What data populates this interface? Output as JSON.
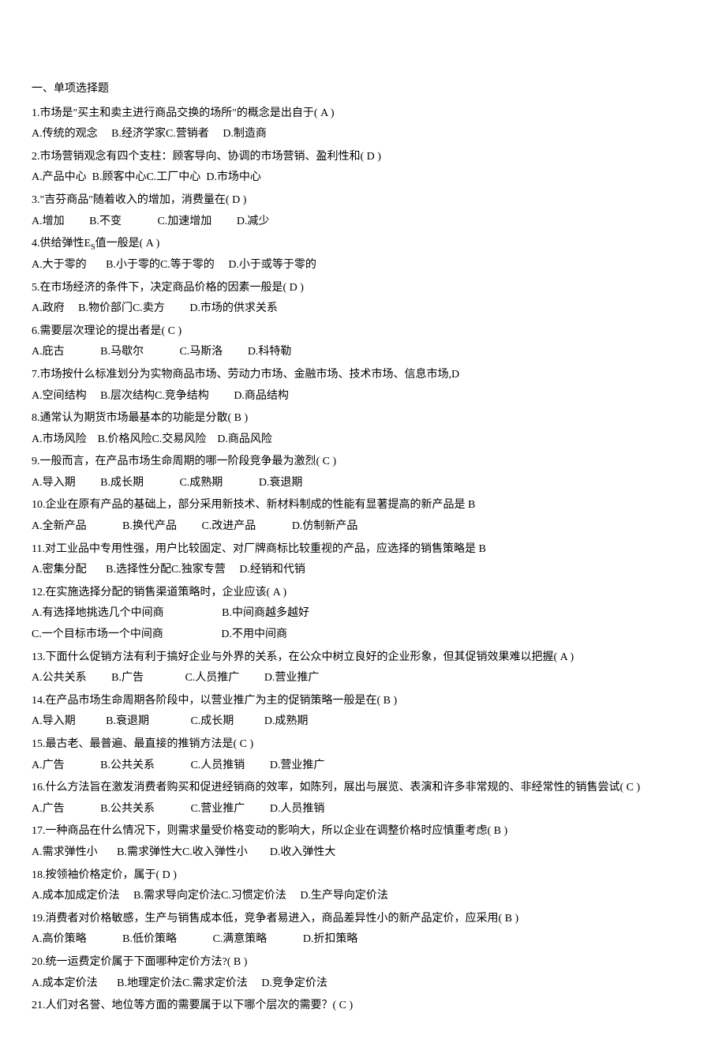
{
  "section_title": "一、单项选择题",
  "questions": [
    {
      "num": "1.",
      "text": "市场是\"买主和卖主进行商品交换的场所\"的概念是出自于(    A    )",
      "options": [
        {
          "label": "A.",
          "text": "传统的观念",
          "pad": "     "
        },
        {
          "label": "B.",
          "text": "经济学家",
          "pad": ""
        },
        {
          "label": "C.",
          "text": "营销者",
          "pad": "     "
        },
        {
          "label": "D.",
          "text": "制造商",
          "pad": ""
        }
      ]
    },
    {
      "num": "2.",
      "text": "市场营销观念有四个支柱：顾客导向、协调的市场营销、盈利性和(     D   )",
      "options": [
        {
          "label": "A.",
          "text": "产品中心",
          "pad": "  "
        },
        {
          "label": "B.",
          "text": "顾客中心",
          "pad": ""
        },
        {
          "label": "C.",
          "text": "工厂中心",
          "pad": "  "
        },
        {
          "label": "D.",
          "text": "市场中心",
          "pad": ""
        }
      ]
    },
    {
      "num": "3.",
      "text": "\"吉芬商品\"随着收入的增加，消费量在(     D   )",
      "options": [
        {
          "label": "A.",
          "text": "增加",
          "pad": "         "
        },
        {
          "label": "B.",
          "text": "不变",
          "pad": "             "
        },
        {
          "label": "C.",
          "text": "加速增加",
          "pad": "         "
        },
        {
          "label": "D.",
          "text": "减少",
          "pad": ""
        }
      ]
    },
    {
      "num": "4.",
      "text": "供给弹性E<sub>S</sub>值一般是( A     )",
      "options": [
        {
          "label": "A.",
          "text": "大于零的",
          "pad": "       "
        },
        {
          "label": "B.",
          "text": "小于零的",
          "pad": ""
        },
        {
          "label": "C.",
          "text": "等于零的",
          "pad": "     "
        },
        {
          "label": "D.",
          "text": "小于或等于零的",
          "pad": ""
        }
      ]
    },
    {
      "num": "5.",
      "text": "在市场经济的条件下，决定商品价格的因素一般是(    D    )",
      "options": [
        {
          "label": "A.",
          "text": "政府",
          "pad": "     "
        },
        {
          "label": "B.",
          "text": "物价部门",
          "pad": ""
        },
        {
          "label": "C.",
          "text": "卖方",
          "pad": "         "
        },
        {
          "label": "D.",
          "text": "市场的供求关系",
          "pad": ""
        }
      ]
    },
    {
      "num": "6.",
      "text": "需要层次理论的提出者是(  C     )",
      "options": [
        {
          "label": "A.",
          "text": "庇古",
          "pad": "             "
        },
        {
          "label": "B.",
          "text": "马歇尔",
          "pad": "             "
        },
        {
          "label": "C.",
          "text": "马斯洛",
          "pad": "         "
        },
        {
          "label": "D.",
          "text": "科特勒",
          "pad": ""
        }
      ]
    },
    {
      "num": "7.",
      "text": "市场按什么标准划分为实物商品市场、劳动力市场、金融市场、技术市场、信息市场,D",
      "options": [
        {
          "label": "A.",
          "text": "空间结构",
          "pad": "     "
        },
        {
          "label": "B.",
          "text": "层次结构",
          "pad": ""
        },
        {
          "label": "C.",
          "text": "竞争结构",
          "pad": "         "
        },
        {
          "label": "D.",
          "text": "商品结构",
          "pad": ""
        }
      ]
    },
    {
      "num": "8.",
      "text": "通常认为期货市场最基本的功能是分散(    B    )",
      "options": [
        {
          "label": "A.",
          "text": "市场风险",
          "pad": "    "
        },
        {
          "label": "B.",
          "text": "价格风险",
          "pad": ""
        },
        {
          "label": "C.",
          "text": "交易风险",
          "pad": "    "
        },
        {
          "label": "D.",
          "text": "商品风险",
          "pad": ""
        }
      ]
    },
    {
      "num": "9.",
      "text": "一般而言，在产品市场生命周期的哪一阶段竞争最为激烈(     C    )",
      "options": [
        {
          "label": "A.",
          "text": "导入期",
          "pad": "         "
        },
        {
          "label": "B.",
          "text": "成长期",
          "pad": "             "
        },
        {
          "label": "C.",
          "text": "成熟期",
          "pad": "             "
        },
        {
          "label": "D.",
          "text": "衰退期",
          "pad": ""
        }
      ]
    },
    {
      "num": "10.",
      "text": "企业在原有产品的基础上，部分采用新技术、新材料制成的性能有显著提高的新产品是 B",
      "options": [
        {
          "label": "A.",
          "text": "全新产品",
          "pad": "             "
        },
        {
          "label": "B.",
          "text": "换代产品",
          "pad": "         "
        },
        {
          "label": "C.",
          "text": "改进产品",
          "pad": "             "
        },
        {
          "label": "D.",
          "text": "仿制新产品",
          "pad": ""
        }
      ]
    },
    {
      "num": "11.",
      "text": "对工业品中专用性强，用户比较固定、对厂牌商标比较重视的产品，应选择的销售策略是 B",
      "options": [
        {
          "label": "A.",
          "text": "密集分配",
          "pad": "       "
        },
        {
          "label": "B.",
          "text": "选择性分配",
          "pad": ""
        },
        {
          "label": "C.",
          "text": "独家专营",
          "pad": "     "
        },
        {
          "label": "D.",
          "text": "经销和代销",
          "pad": ""
        }
      ]
    },
    {
      "num": "12.",
      "text": "在实施选择分配的销售渠道策略时，企业应该(  A    )",
      "options_rows": [
        [
          {
            "label": "A.",
            "text": "有选择地挑选几个中间商",
            "pad": "                     "
          },
          {
            "label": "B.",
            "text": "中间商越多越好",
            "pad": ""
          }
        ],
        [
          {
            "label": "C.",
            "text": "一个目标市场一个中间商",
            "pad": "                     "
          },
          {
            "label": "D.",
            "text": "不用中间商",
            "pad": ""
          }
        ]
      ]
    },
    {
      "num": "13.",
      "text": "下面什么促销方法有利于搞好企业与外界的关系，在公众中树立良好的企业形象，但其促销效果难以把握(     A   )",
      "options": [
        {
          "label": "A.",
          "text": "公共关系",
          "pad": "         "
        },
        {
          "label": "B.",
          "text": "广告",
          "pad": "               "
        },
        {
          "label": "C.",
          "text": "人员推广",
          "pad": "         "
        },
        {
          "label": "D.",
          "text": "营业推广",
          "pad": ""
        }
      ]
    },
    {
      "num": "14.",
      "text": "在产品市场生命周期各阶段中，以营业推广为主的促销策略一般是在( B      )",
      "options": [
        {
          "label": "A.",
          "text": "导入期",
          "pad": "           "
        },
        {
          "label": "B.",
          "text": "衰退期",
          "pad": "               "
        },
        {
          "label": "C.",
          "text": "成长期",
          "pad": "           "
        },
        {
          "label": "D.",
          "text": "成熟期",
          "pad": ""
        }
      ]
    },
    {
      "num": "15.",
      "text": "最古老、最普遍、最直接的推销方法是(    C    )",
      "options": [
        {
          "label": "A.",
          "text": "广告",
          "pad": "             "
        },
        {
          "label": "B.",
          "text": "公共关系",
          "pad": "             "
        },
        {
          "label": "C.",
          "text": "人员推销",
          "pad": "         "
        },
        {
          "label": "D.",
          "text": "营业推广",
          "pad": ""
        }
      ]
    },
    {
      "num": "16.",
      "text": "什么方法旨在激发消费者购买和促进经销商的效率，如陈列，展出与展览、表演和许多非常规的、非经常性的销售尝试(     C   )",
      "options": [
        {
          "label": "A.",
          "text": "广告",
          "pad": "             "
        },
        {
          "label": "B.",
          "text": "公共关系",
          "pad": "             "
        },
        {
          "label": "C.",
          "text": "营业推广",
          "pad": "         "
        },
        {
          "label": "D.",
          "text": "人员推销",
          "pad": ""
        }
      ]
    },
    {
      "num": "17.",
      "text": "一种商品在什么情况下，则需求量受价格变动的影响大，所以企业在调整价格时应慎重考虑(      B  )",
      "options": [
        {
          "label": "A.",
          "text": "需求弹性小",
          "pad": "       "
        },
        {
          "label": "B.",
          "text": "需求弹性大",
          "pad": ""
        },
        {
          "label": "C.",
          "text": "收入弹性小",
          "pad": "        "
        },
        {
          "label": "D.",
          "text": "收入弹性大",
          "pad": ""
        }
      ]
    },
    {
      "num": "18.",
      "text": "按领袖价格定价，属于(  D     )",
      "options": [
        {
          "label": "A.",
          "text": "成本加成定价法",
          "pad": "     "
        },
        {
          "label": "B.",
          "text": "需求导向定价法",
          "pad": ""
        },
        {
          "label": "C.",
          "text": "习惯定价法",
          "pad": "     "
        },
        {
          "label": "D.",
          "text": "生产导向定价法",
          "pad": ""
        }
      ]
    },
    {
      "num": "19.",
      "text": "消费者对价格敏感，生产与销售成本低，竞争者易进入，商品差异性小的新产品定价，应采用( B      )",
      "options": [
        {
          "label": "A.",
          "text": "高价策略",
          "pad": "             "
        },
        {
          "label": "B.",
          "text": "低价策略",
          "pad": "             "
        },
        {
          "label": "C.",
          "text": "满意策略",
          "pad": "             "
        },
        {
          "label": "D.",
          "text": "折扣策略",
          "pad": ""
        }
      ]
    },
    {
      "num": "20.",
      "text": "统一运费定价属于下面哪种定价方法?(    B    )",
      "options": [
        {
          "label": "A.",
          "text": "成本定价法",
          "pad": "       "
        },
        {
          "label": "B.",
          "text": "地理定价法",
          "pad": ""
        },
        {
          "label": "C.",
          "text": "需求定价法",
          "pad": "     "
        },
        {
          "label": "D.",
          "text": "竞争定价法",
          "pad": ""
        }
      ]
    },
    {
      "num": "21.",
      "text": "人们对名誉、地位等方面的需要属于以下哪个层次的需要？(      C   )",
      "options": []
    }
  ]
}
